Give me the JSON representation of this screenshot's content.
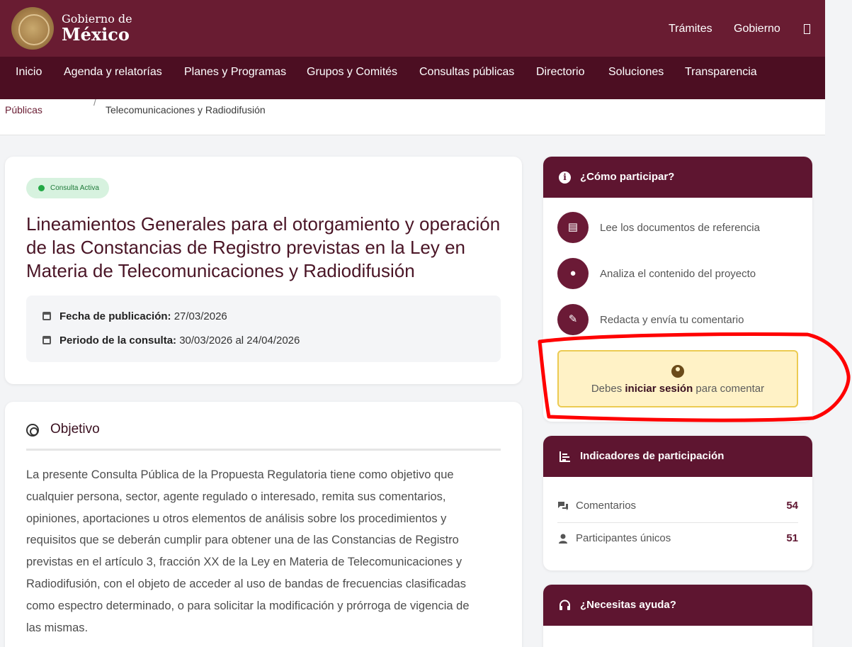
{
  "header": {
    "logo_icon": "seal-icon",
    "brand_line1": "Gobierno de",
    "brand_line2": "México",
    "links": [
      "Trámites",
      "Gobierno"
    ],
    "search_icon": "search-icon"
  },
  "nav": {
    "items": [
      "Inicio",
      "Agenda y relatorías",
      "Planes y Programas",
      "Grupos y Comités",
      "Consultas públicas",
      "Directorio",
      "Soluciones",
      "Transparencia"
    ]
  },
  "breadcrumb": {
    "prev": "Públicas",
    "separator": "/",
    "current": "Telecomunicaciones y Radiodifusión"
  },
  "consulta": {
    "status": "Consulta Activa",
    "title": "Lineamientos Generales para el otorgamiento y operación de las Constancias de Registro previstas en la Ley en Materia de Telecomunicaciones y Radiodifusión",
    "pub_label": "Fecha de publicación:",
    "pub_value": "27/03/2026",
    "period_label": "Periodo de la consulta:",
    "period_value": "30/03/2026 al 24/04/2026"
  },
  "objetivo": {
    "heading": "Objetivo",
    "lines": [
      "La presente Consulta Pública de la Propuesta Regulatoria tiene como objetivo que",
      "cualquier persona, sector, agente regulado o interesado, remita sus comentarios,",
      "opiniones, aportaciones u otros elementos de análisis sobre los procedimientos y",
      "requisitos que se deberán cumplir para obtener una de las Constancias de Registro",
      "previstas en el artículo 3, fracción XX de la Ley en Materia de Telecomunicaciones y",
      "Radiodifusión, con el objeto de acceder al uso de bandas de frecuencias clasificadas",
      "como espectro determinado, o para solicitar la modificación y prórroga de vigencia de",
      "las mismas."
    ]
  },
  "participar": {
    "heading": "¿Cómo participar?",
    "steps": [
      {
        "icon": "document-icon",
        "label": "Lee los documentos de referencia"
      },
      {
        "icon": "lightbulb-icon",
        "label": "Analiza el contenido del proyecto"
      },
      {
        "icon": "pencil-icon",
        "label": "Redacta y envía tu comentario"
      }
    ],
    "login_prefix": "Debes ",
    "login_link": "iniciar sesión",
    "login_suffix": " para comentar"
  },
  "indicadores": {
    "heading": "Indicadores de participación",
    "rows": [
      {
        "label": "Comentarios",
        "value": "54"
      },
      {
        "label": "Participantes únicos",
        "value": "51"
      }
    ]
  },
  "ayuda": {
    "heading": "¿Necesitas ayuda?"
  },
  "colors": {
    "brand": "#691c32",
    "nav": "#4c0e22",
    "highlight": "#ff0000",
    "login_bg": "#fff2c6"
  }
}
